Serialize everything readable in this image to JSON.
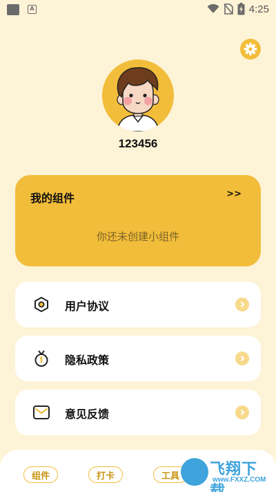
{
  "status_bar": {
    "time": "4:25",
    "notification_icon_letter": "A"
  },
  "profile": {
    "username": "123456"
  },
  "widgets": {
    "title": "我的组件",
    "more_label": ">>",
    "empty_text": "你还未创建小组件"
  },
  "menu": {
    "items": [
      {
        "label": "用户协议",
        "icon": "hexagon-nut-icon"
      },
      {
        "label": "隐私政策",
        "icon": "medal-icon"
      },
      {
        "label": "意见反馈",
        "icon": "envelope-icon"
      }
    ]
  },
  "tabbar": {
    "tabs": [
      {
        "label": "组件"
      },
      {
        "label": "打卡"
      },
      {
        "label": "工具"
      }
    ]
  },
  "watermark": {
    "main": "飞翔下载",
    "sub": "www.FXXZ.COM"
  },
  "colors": {
    "background": "#fdf3d6",
    "accent": "#f2bd3a",
    "card": "#ffffff",
    "watermark": "#3fa3dc"
  }
}
